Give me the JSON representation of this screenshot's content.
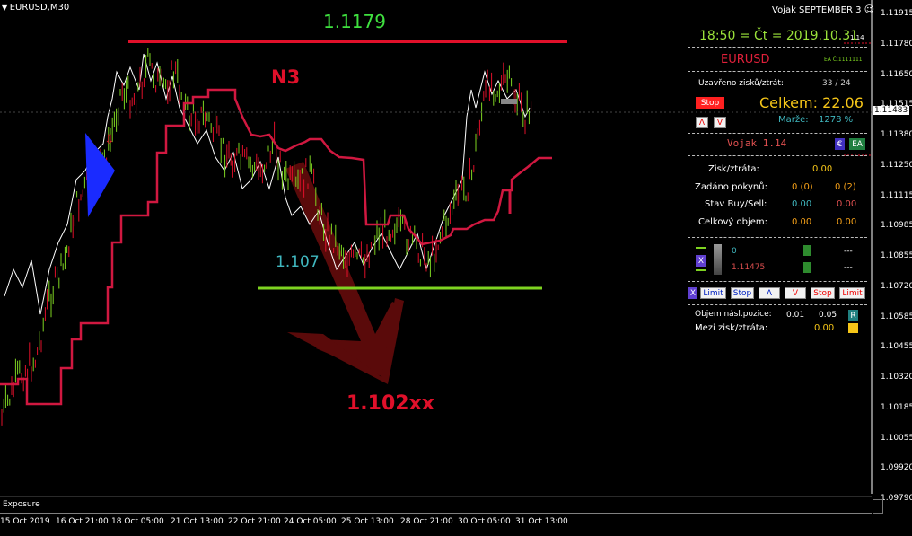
{
  "window": {
    "symbol_title": "EURUSD,M30",
    "top_right": "Vojak SEPTEMBER 3",
    "smile_icon": "smiley-icon"
  },
  "annotations": {
    "top_level": "1.1179",
    "label_n3": "N3",
    "mid_level": "1.107",
    "target_level": "1.102xx"
  },
  "price_axis": [
    "1.11915",
    "1.11780",
    "1.11650",
    "1.11515",
    "1.11380",
    "1.11250",
    "1.11115",
    "1.10985",
    "1.10855",
    "1.10720",
    "1.10585",
    "1.10455",
    "1.10320",
    "1.10185",
    "1.10055",
    "1.09920",
    "1.09790"
  ],
  "current_price_tag": "1.11483",
  "time_axis": [
    "15 Oct 2019",
    "16 Oct 21:00",
    "18 Oct 05:00",
    "21 Oct 13:00",
    "22 Oct 21:00",
    "24 Oct 05:00",
    "25 Oct 13:00",
    "28 Oct 21:00",
    "30 Oct 05:00",
    "31 Oct 13:00"
  ],
  "bottom_tab": "Exposure",
  "panel": {
    "clock": "18:50 = Čt = 2019.10.31",
    "clock_suffix": "1.14",
    "symbol": "EURUSD",
    "ea_tag": "EA Č.1111111",
    "closed_label": "Uzavřeno zisků/ztrát:",
    "closed_value": "33 / 24",
    "stop_button": "Stop",
    "total_label": "Celkem: 22.06",
    "up_button": "Λ",
    "down_button": "V",
    "margin_label": "Marže:",
    "margin_value": "1278 %",
    "brand": "Vojak 1.14",
    "euro_button": "€",
    "ea_button": "EA",
    "profit_label": "Zisk/ztráta:",
    "profit_value": "0.00",
    "orders_label": "Zadáno pokynů:",
    "orders_buy": "0 (0)",
    "orders_sell": "0 (2)",
    "state_label": "Stav Buy/Sell:",
    "state_buy": "0.00",
    "state_sell": "0.00",
    "volume_label": "Celkový objem:",
    "volume_buy": "0.00",
    "volume_sell": "0.00",
    "line1_value": "0",
    "line2_value": "1.11475",
    "dashes1": "---",
    "dashes2": "---",
    "x_button": "X",
    "action_buttons": {
      "x": "X",
      "limit_buy": "Limit",
      "stop_buy": "Stop",
      "up": "Λ",
      "down": "V",
      "stop_sell": "Stop",
      "limit_sell": "Limit"
    },
    "next_volume_label": "Objem násl.pozice:",
    "next_volume_a": "0.01",
    "next_volume_b": "0.05",
    "r_button": "R",
    "mid_profit_label": "Mezi zisk/ztráta:",
    "mid_profit_value": "0.00"
  },
  "colors": {
    "background": "#000000",
    "resistance_line": "#e0102a",
    "support_line": "#7ed321",
    "indicator": "#d01840",
    "candle_up": "#7ed321",
    "candle_down": "#e0102a",
    "arrow": "#5a0a0a"
  }
}
